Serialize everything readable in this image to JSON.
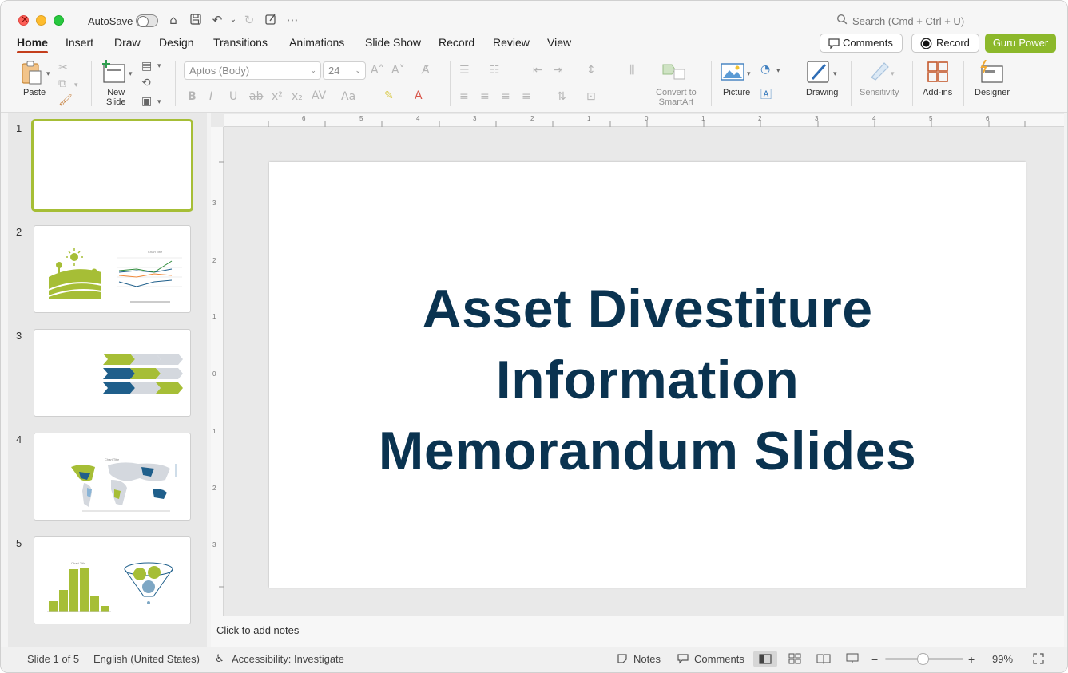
{
  "titlebar": {
    "autosave_label": "AutoSave",
    "search_placeholder": "Search (Cmd + Ctrl + U)"
  },
  "tabs": [
    "Home",
    "Insert",
    "Draw",
    "Design",
    "Transitions",
    "Animations",
    "Slide Show",
    "Record",
    "Review",
    "View"
  ],
  "header_buttons": {
    "comments": "Comments",
    "record": "Record",
    "guru": "Guru Power"
  },
  "ribbon": {
    "paste": "Paste",
    "new_slide_line1": "New",
    "new_slide_line2": "Slide",
    "font_name": "Aptos (Body)",
    "font_size": "24",
    "convert_line1": "Convert to",
    "convert_line2": "SmartArt",
    "picture": "Picture",
    "drawing": "Drawing",
    "sensitivity": "Sensitivity",
    "addins": "Add-ins",
    "designer": "Designer"
  },
  "slides": [
    {
      "num": "1"
    },
    {
      "num": "2"
    },
    {
      "num": "3"
    },
    {
      "num": "4"
    },
    {
      "num": "5"
    }
  ],
  "thumb_text": {
    "chart_title": "Chart Title"
  },
  "slide": {
    "title_line1": "Asset Divestiture",
    "title_line2": "Information",
    "title_line3": "Memorandum Slides"
  },
  "notes_placeholder": "Click to add notes",
  "status": {
    "slide_of": "Slide 1 of 5",
    "language": "English (United States)",
    "accessibility": "Accessibility: Investigate",
    "notes": "Notes",
    "comments": "Comments",
    "zoom": "99%"
  },
  "colors": {
    "accent_green": "#8cb82b",
    "title_navy": "#0a3350",
    "tab_underline": "#c43e1c"
  }
}
